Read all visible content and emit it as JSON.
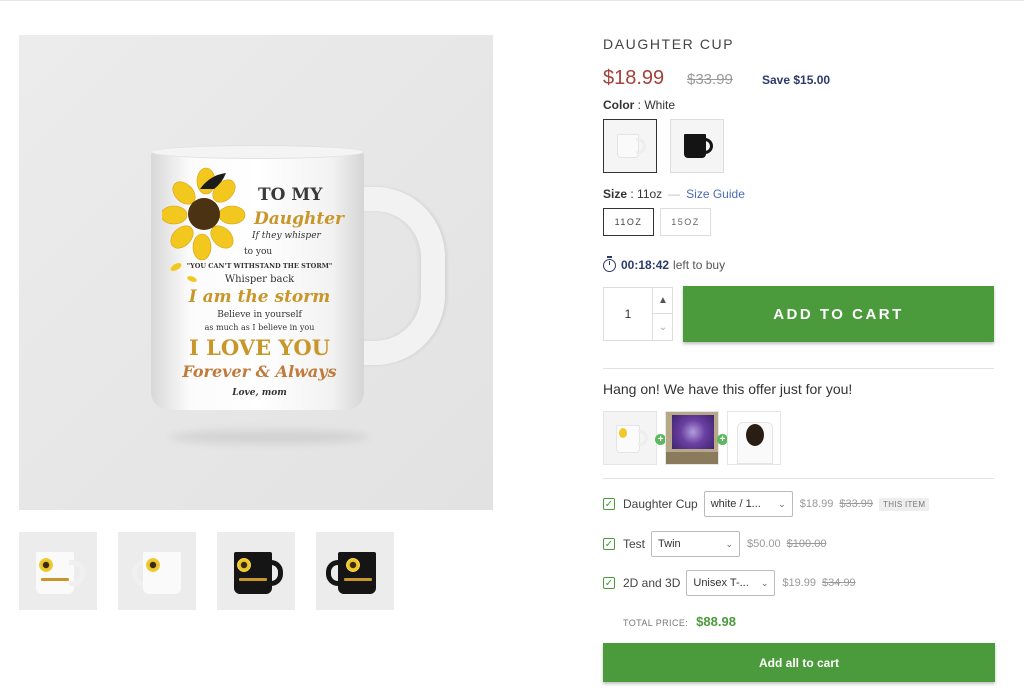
{
  "product": {
    "title": "DAUGHTER CUP",
    "price": "$18.99",
    "old_price": "$33.99",
    "save": "Save $15.00",
    "color_label": "Color",
    "color_value": "White",
    "colors": [
      "White",
      "Black"
    ],
    "size_label": "Size",
    "size_value": "11oz",
    "size_guide": "Size Guide",
    "sizes": [
      "11OZ",
      "15OZ"
    ],
    "timer": {
      "time": "00:18:42",
      "text": "left to buy",
      "icon": "stopwatch-icon"
    },
    "quantity": "1",
    "add_to_cart": "ADD TO CART"
  },
  "mug_print": {
    "line1": "TO MY",
    "line2": "Daughter",
    "line3": "If they whisper",
    "line4": "to you",
    "line5": "\"YOU CAN'T WITHSTAND THE STORM\"",
    "line6": "Whisper back",
    "line7": "I am the storm",
    "line8": "Believe in yourself",
    "line9": "as much as I believe in you",
    "line10": "I LOVE YOU",
    "line11": "Forever & Always",
    "line12": "Love, mom"
  },
  "bundle": {
    "title": "Hang on! We have this offer just for you!",
    "items": [
      {
        "name": "Daughter Cup",
        "select": "white / 1...",
        "price": "$18.99",
        "old": "$33.99",
        "tag": "THIS ITEM"
      },
      {
        "name": "Test",
        "select": "Twin",
        "price": "$50.00",
        "old": "$100.00",
        "tag": ""
      },
      {
        "name": "2D and 3D",
        "select": "Unisex T-...",
        "price": "$19.99",
        "old": "$34.99",
        "tag": ""
      }
    ],
    "total_label": "TOTAL PRICE:",
    "total_value": "$88.98",
    "add_all": "Add all to cart"
  },
  "colors": {
    "accent_green": "#4b9a3c",
    "price_red": "#a3413a",
    "save_navy": "#2d3a6b",
    "link_blue": "#4b6cb7"
  }
}
